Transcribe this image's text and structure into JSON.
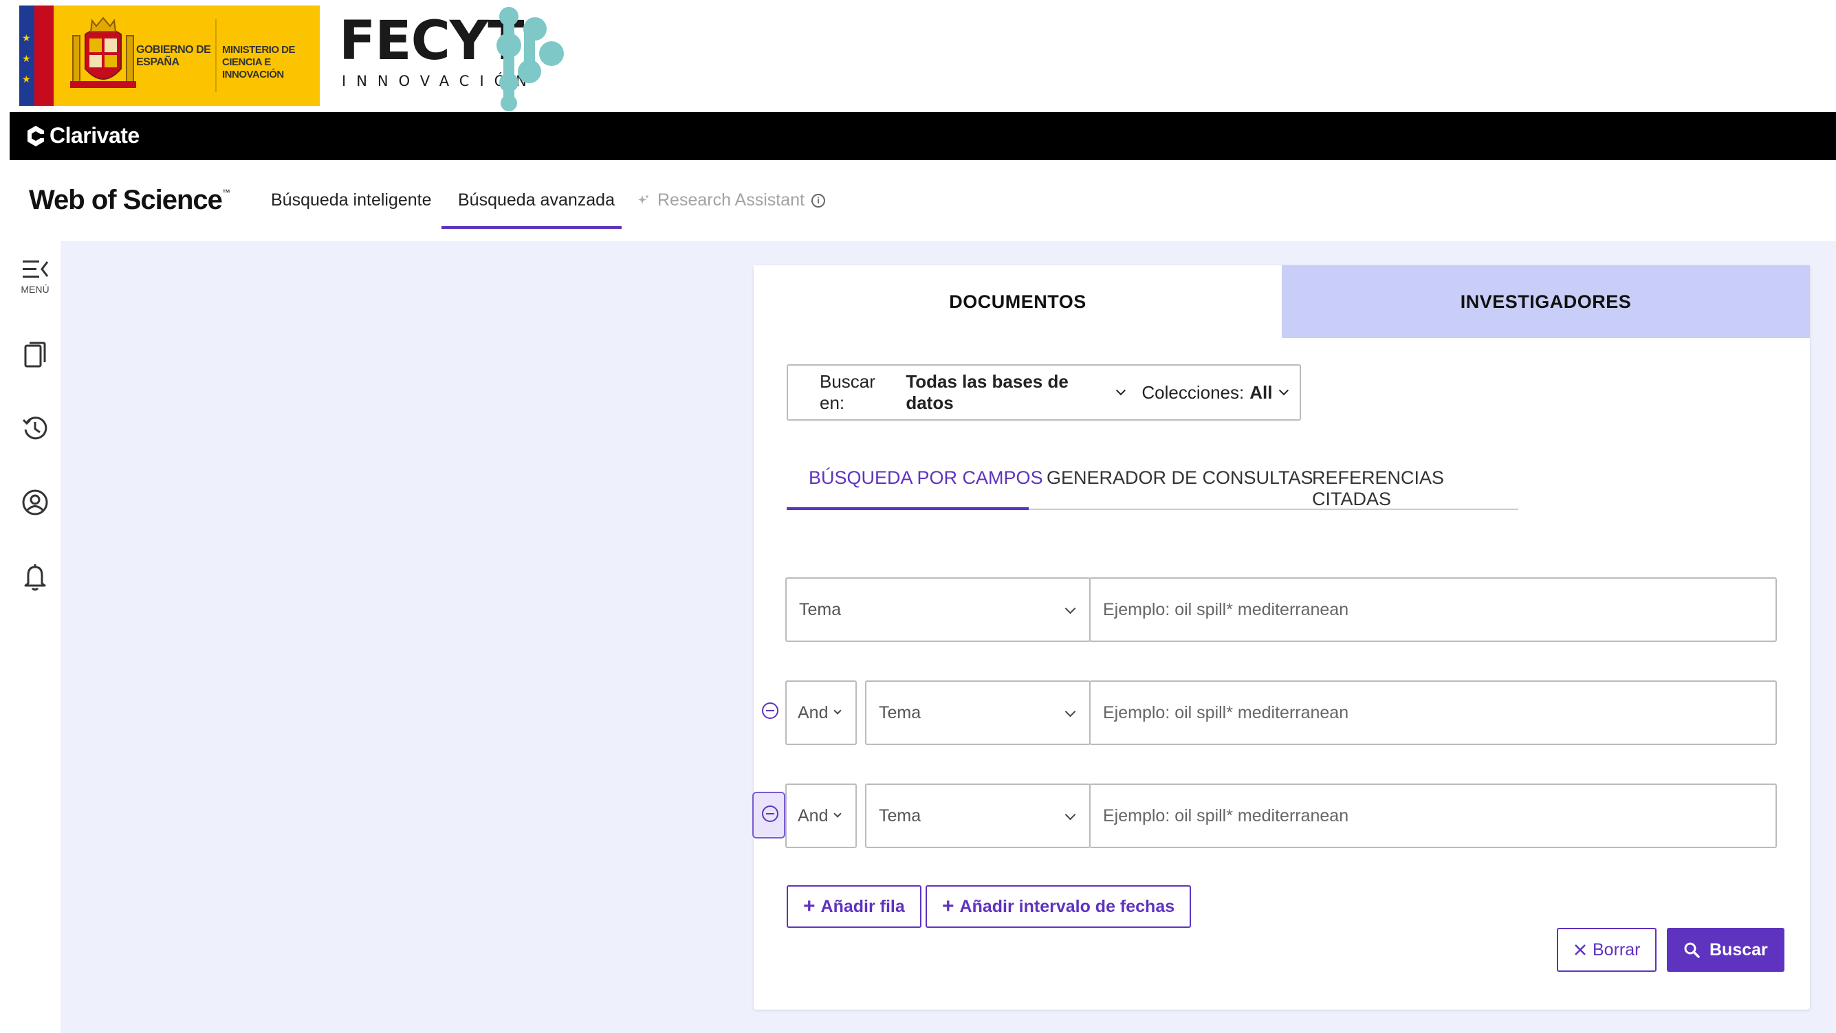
{
  "gov": {
    "line1": "GOBIERNO DE ESPAÑA",
    "line2": "MINISTERIO DE CIENCIA E INNOVACIÓN"
  },
  "fecyt": {
    "name": "FECYT",
    "sub": "INNOVACIÓN"
  },
  "clarivate": {
    "name": "Clarivate"
  },
  "header": {
    "title": "Web of Science",
    "trademark": "™",
    "nav": {
      "smart": "Búsqueda inteligente",
      "advanced": "Búsqueda avanzada",
      "assistant": "Research Assistant"
    }
  },
  "rail": {
    "menu_label": "MENÚ"
  },
  "card": {
    "tabs": {
      "documents": "DOCUMENTOS",
      "researchers": "INVESTIGADORES"
    },
    "db_select": {
      "search_in_label": "Buscar en:",
      "search_in_value": "Todas las bases de datos",
      "collections_label": "Colecciones:",
      "collections_value": "All"
    },
    "subtabs": {
      "fields": "BÚSQUEDA POR CAMPOS",
      "query_builder": "GENERADOR DE CONSULTAS",
      "cited_refs": "REFERENCIAS CITADAS"
    },
    "rows": [
      {
        "field": "Tema",
        "placeholder": "Ejemplo: oil spill* mediterranean",
        "value": ""
      },
      {
        "operator": "And",
        "field": "Tema",
        "placeholder": "Ejemplo: oil spill* mediterranean",
        "value": ""
      },
      {
        "operator": "And",
        "field": "Tema",
        "placeholder": "Ejemplo: oil spill* mediterranean",
        "value": ""
      }
    ],
    "add_row": "Añadir fila",
    "add_date_range": "Añadir intervalo de fechas",
    "clear": "Borrar",
    "search": "Buscar"
  },
  "colors": {
    "accent": "#5e33bf",
    "tab_inactive": "#c9cef8",
    "main_bg": "#eef0fc",
    "gov_yellow": "#fcc300"
  }
}
